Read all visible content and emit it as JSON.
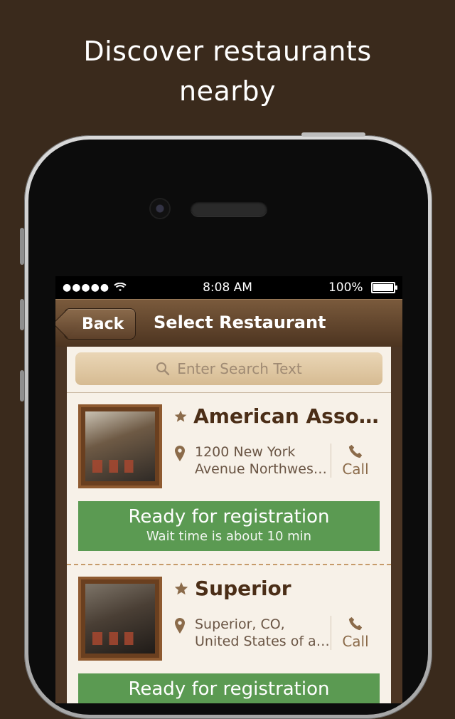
{
  "headline": {
    "line1": "Discover restaurants",
    "line2": "nearby"
  },
  "status_bar": {
    "signal": "●●●●●",
    "time": "8:08 AM",
    "battery": "100%"
  },
  "nav": {
    "back_label": "Back",
    "title": "Select Restaurant"
  },
  "search": {
    "placeholder": "Enter Search Text"
  },
  "restaurants": [
    {
      "name": "American Associ…",
      "address_line1": "1200 New York",
      "address_line2": "Avenue Northwes…",
      "call_label": "Call",
      "status_title": "Ready for registration",
      "status_sub": "Wait time is about 10 min"
    },
    {
      "name": "Superior",
      "address_line1": "Superior, CO,",
      "address_line2": "United States of a…",
      "call_label": "Call",
      "status_title": "Ready for registration",
      "status_sub": ""
    }
  ],
  "colors": {
    "background": "#3a2a1c",
    "ready": "#5b9a52",
    "name": "#4b2e17"
  }
}
